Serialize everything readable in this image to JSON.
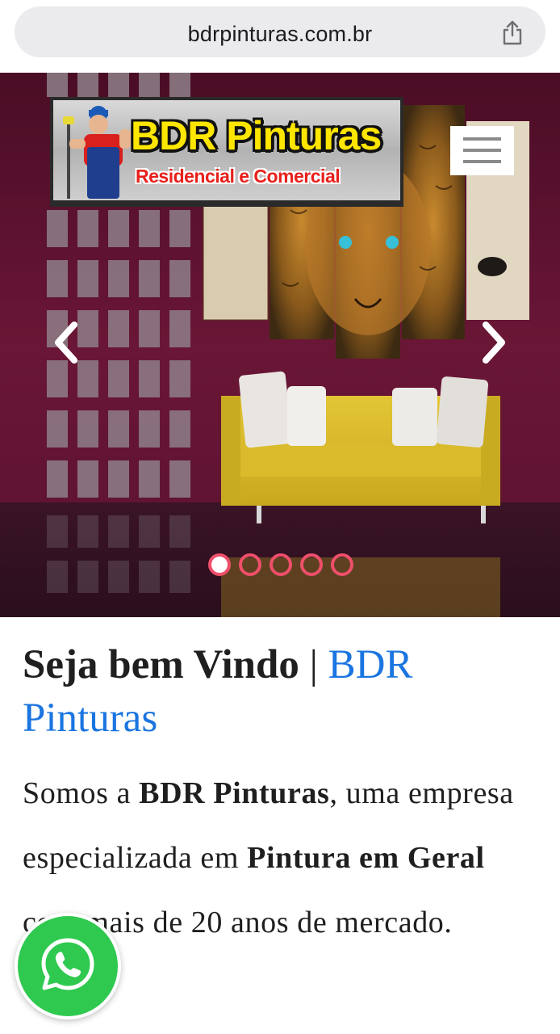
{
  "browser": {
    "url": "bdrpinturas.com.br",
    "share_icon": "share-icon"
  },
  "header": {
    "logo": {
      "title": "BDR Pinturas",
      "subtitle": "Residencial e Comercial"
    },
    "menu_icon": "hamburger-menu-icon"
  },
  "carousel": {
    "prev_icon": "chevron-left-icon",
    "next_icon": "chevron-right-icon",
    "slide_count": 5,
    "active_slide": 1
  },
  "welcome": {
    "heading_bold": "Seja bem Vindo",
    "heading_separator": "|",
    "heading_brand": "BDR Pinturas",
    "paragraph": {
      "part1": "Somos a ",
      "bold1": "BDR Pinturas",
      "part2": ", uma empresa especializada em ",
      "bold2": "Pintura em Geral",
      "part3": " com mais de 20 anos de mercado."
    }
  },
  "whatsapp": {
    "icon": "whatsapp-icon"
  },
  "colors": {
    "wall": "#5e1230",
    "brand_blue": "#1a75e0",
    "whatsapp_green": "#2fc94f",
    "indicator": "#ee4f6a"
  }
}
